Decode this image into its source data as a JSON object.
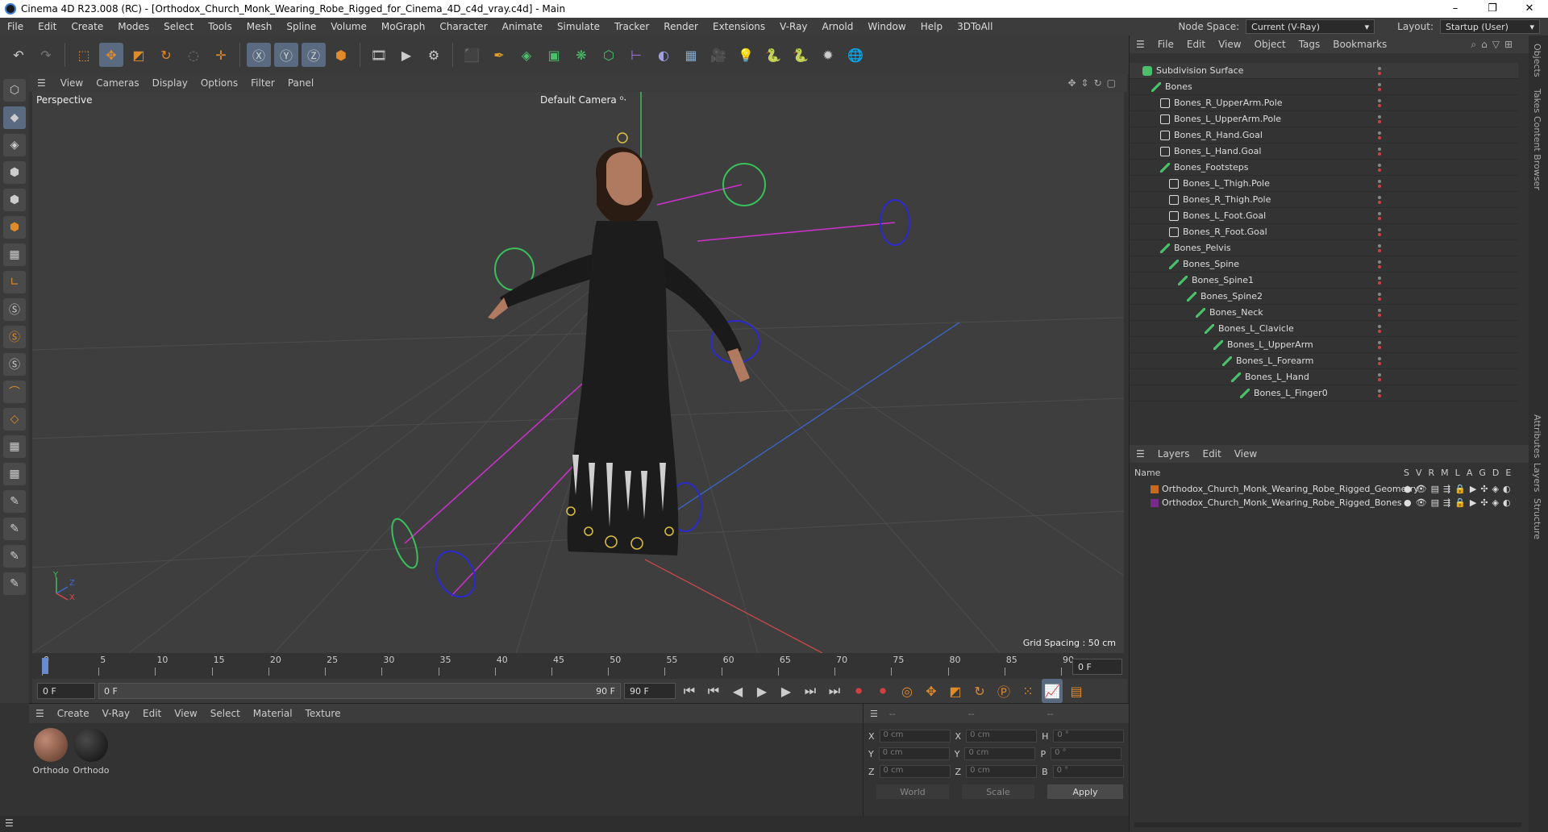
{
  "window": {
    "title": "Cinema 4D R23.008 (RC) - [Orthodox_Church_Monk_Wearing_Robe_Rigged_for_Cinema_4D_c4d_vray.c4d] - Main",
    "controls": [
      "–",
      "❐",
      "✕"
    ]
  },
  "menubar": {
    "items": [
      "File",
      "Edit",
      "Create",
      "Modes",
      "Select",
      "Tools",
      "Mesh",
      "Spline",
      "Volume",
      "MoGraph",
      "Character",
      "Animate",
      "Simulate",
      "Tracker",
      "Render",
      "Extensions",
      "V-Ray",
      "Arnold",
      "Window",
      "Help",
      "3DToAll"
    ],
    "node_space_label": "Node Space:",
    "node_space_value": "Current (V-Ray)",
    "layout_label": "Layout:",
    "layout_value": "Startup (User)"
  },
  "viewport": {
    "menu": [
      "View",
      "Cameras",
      "Display",
      "Options",
      "Filter",
      "Panel"
    ],
    "label": "Perspective",
    "camera": "Default Camera ⁰·",
    "grid_spacing": "Grid Spacing : 50 cm",
    "axis_labels": [
      "Y",
      "Z",
      "X"
    ]
  },
  "timeline": {
    "ticks": [
      "0",
      "5",
      "10",
      "15",
      "20",
      "25",
      "30",
      "35",
      "40",
      "45",
      "50",
      "55",
      "60",
      "65",
      "70",
      "75",
      "80",
      "85",
      "90"
    ],
    "current_frame": "0 F",
    "start_field": "0 F",
    "range_start": "0 F",
    "range_end": "90 F",
    "end_field": "90 F"
  },
  "materials": {
    "menu": [
      "Create",
      "V-Ray",
      "Edit",
      "View",
      "Select",
      "Material",
      "Texture"
    ],
    "items": [
      {
        "label": "Orthodo",
        "color": "#8a5a48"
      },
      {
        "label": "Orthodo",
        "color": "#1c1c1c"
      }
    ]
  },
  "attributes": {
    "header": [
      "--",
      "--",
      "--"
    ],
    "rows": [
      {
        "a": "X",
        "v1": "0 cm",
        "b": "X",
        "v2": "0 cm",
        "c": "H",
        "v3": "0 °"
      },
      {
        "a": "Y",
        "v1": "0 cm",
        "b": "Y",
        "v2": "0 cm",
        "c": "P",
        "v3": "0 °"
      },
      {
        "a": "Z",
        "v1": "0 cm",
        "b": "Z",
        "v2": "0 cm",
        "c": "B",
        "v3": "0 °"
      }
    ],
    "coord_mode": "World",
    "scale_mode": "Scale",
    "apply": "Apply"
  },
  "object_manager": {
    "menu": [
      "File",
      "Edit",
      "View",
      "Object",
      "Tags",
      "Bookmarks"
    ],
    "objects": [
      {
        "name": "Subdivision Surface",
        "depth": 0,
        "type": "subd"
      },
      {
        "name": "Bones",
        "depth": 1,
        "type": "bone"
      },
      {
        "name": "Bones_R_UpperArm.Pole",
        "depth": 2,
        "type": "null"
      },
      {
        "name": "Bones_L_UpperArm.Pole",
        "depth": 2,
        "type": "null"
      },
      {
        "name": "Bones_R_Hand.Goal",
        "depth": 2,
        "type": "null"
      },
      {
        "name": "Bones_L_Hand.Goal",
        "depth": 2,
        "type": "null"
      },
      {
        "name": "Bones_Footsteps",
        "depth": 2,
        "type": "bone"
      },
      {
        "name": "Bones_L_Thigh.Pole",
        "depth": 3,
        "type": "null"
      },
      {
        "name": "Bones_R_Thigh.Pole",
        "depth": 3,
        "type": "null"
      },
      {
        "name": "Bones_L_Foot.Goal",
        "depth": 3,
        "type": "null"
      },
      {
        "name": "Bones_R_Foot.Goal",
        "depth": 3,
        "type": "null"
      },
      {
        "name": "Bones_Pelvis",
        "depth": 2,
        "type": "bone"
      },
      {
        "name": "Bones_Spine",
        "depth": 3,
        "type": "bone"
      },
      {
        "name": "Bones_Spine1",
        "depth": 4,
        "type": "bone"
      },
      {
        "name": "Bones_Spine2",
        "depth": 5,
        "type": "bone"
      },
      {
        "name": "Bones_Neck",
        "depth": 6,
        "type": "bone"
      },
      {
        "name": "Bones_L_Clavicle",
        "depth": 7,
        "type": "bone"
      },
      {
        "name": "Bones_L_UpperArm",
        "depth": 8,
        "type": "bone"
      },
      {
        "name": "Bones_L_Forearm",
        "depth": 9,
        "type": "bone"
      },
      {
        "name": "Bones_L_Hand",
        "depth": 10,
        "type": "bone"
      },
      {
        "name": "Bones_L_Finger0",
        "depth": 11,
        "type": "bone"
      }
    ]
  },
  "layers": {
    "menu": [
      "Layers",
      "Edit",
      "View"
    ],
    "name_header": "Name",
    "flags": [
      "S",
      "V",
      "R",
      "M",
      "L",
      "A",
      "G",
      "D",
      "E"
    ],
    "items": [
      {
        "name": "Orthodox_Church_Monk_Wearing_Robe_Rigged_Geometry",
        "color": "#c86a1e"
      },
      {
        "name": "Orthodox_Church_Monk_Wearing_Robe_Rigged_Bones",
        "color": "#7a2a8a"
      }
    ]
  },
  "side_tabs": [
    "Objects",
    "Takes",
    "Content Browser",
    "Attributes",
    "Layers",
    "Structure"
  ]
}
